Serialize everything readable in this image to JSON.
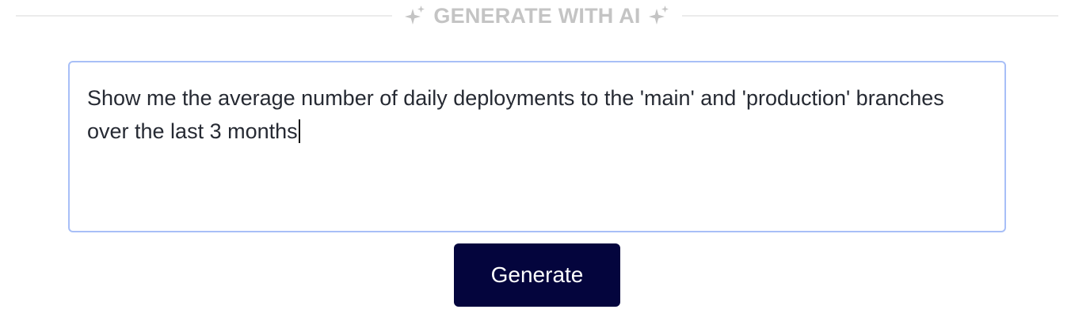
{
  "header": {
    "label": "GENERATE WITH AI",
    "left_icon": "sparkle-icon",
    "right_icon": "sparkle-icon",
    "color": "#c4c4c4"
  },
  "prompt": {
    "value": "Show me the average number of daily deployments to the 'main' and 'production' branches over the last 3 months",
    "focused": true,
    "border_color": "#a8bff7"
  },
  "actions": {
    "generate_label": "Generate",
    "generate_color": "#04053d"
  }
}
